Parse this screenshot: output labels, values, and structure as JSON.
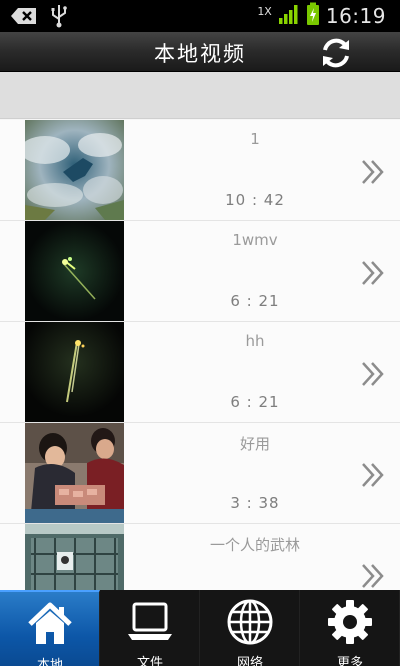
{
  "status_bar": {
    "network": "1X",
    "time": "16:19"
  },
  "header": {
    "title": "本地视频"
  },
  "videos": [
    {
      "name": "1",
      "duration": "10 : 42"
    },
    {
      "name": "1wmv",
      "duration": "6 : 21"
    },
    {
      "name": "hh",
      "duration": "6 : 21"
    },
    {
      "name": "好用",
      "duration": "3 : 38"
    },
    {
      "name": "一个人的武林",
      "duration": ""
    }
  ],
  "bottom_nav": {
    "items": [
      {
        "label": "本地",
        "icon": "home-icon",
        "active": true
      },
      {
        "label": "文件",
        "icon": "laptop-icon",
        "active": false
      },
      {
        "label": "网络",
        "icon": "globe-icon",
        "active": false
      },
      {
        "label": "更多",
        "icon": "gear-icon",
        "active": false
      }
    ]
  },
  "colors": {
    "active_tab": "#0d57a8",
    "battery": "#7ac800",
    "signal": "#8ad400"
  }
}
